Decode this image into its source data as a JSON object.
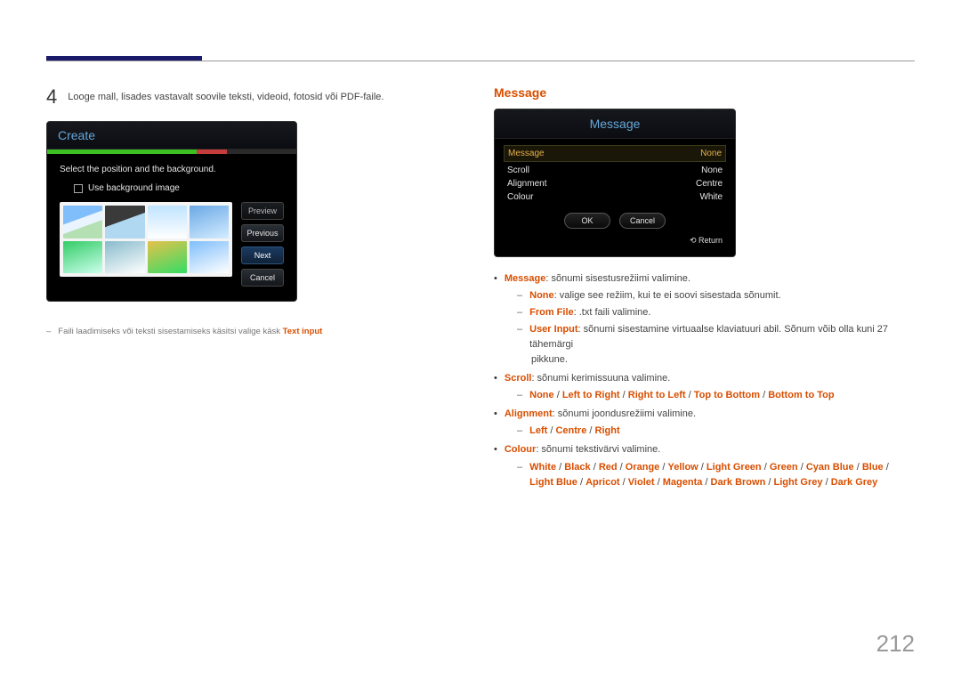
{
  "page_number": "212",
  "left": {
    "step_number": "4",
    "step_text": "Looge mall, lisades vastavalt soovile teksti, videoid, fotosid või PDF-faile.",
    "panel": {
      "title": "Create",
      "subhead": "Select the position and the background.",
      "checkbox_label": "Use background image",
      "buttons": {
        "preview": "Preview",
        "previous": "Previous",
        "next": "Next",
        "cancel": "Cancel"
      }
    },
    "note_prefix": "Faili laadimiseks või teksti sisestamiseks käsitsi valige käsk ",
    "note_highlight": "Text input"
  },
  "right": {
    "heading": "Message",
    "panel": {
      "title": "Message",
      "rows": {
        "message_lbl": "Message",
        "message_val": "None",
        "scroll_lbl": "Scroll",
        "scroll_val": "None",
        "align_lbl": "Alignment",
        "align_val": "Centre",
        "colour_lbl": "Colour",
        "colour_val": "White"
      },
      "ok": "OK",
      "cancel": "Cancel",
      "return": "Return"
    },
    "items": {
      "message_lbl": "Message",
      "message_txt": ": sõnumi sisestusrežiimi valimine.",
      "none_lbl": "None",
      "none_txt": ": valige see režiim, kui te ei soovi sisestada sõnumit.",
      "fromfile_lbl": "From File",
      "fromfile_txt": ": .txt faili valimine.",
      "userinput_lbl": "User Input",
      "userinput_txt": ": sõnumi sisestamine virtuaalse klaviatuuri abil. Sõnum võib olla kuni 27 tähemärgi",
      "userinput_cont": "pikkune.",
      "scroll_lbl": "Scroll",
      "scroll_txt": ": sõnumi kerimissuuna valimine.",
      "scroll_opts": [
        "None",
        "Left to Right",
        "Right to Left",
        "Top to Bottom",
        "Bottom to Top"
      ],
      "alignment_lbl": "Alignment",
      "alignment_txt": ": sõnumi joondusrežiimi valimine.",
      "alignment_opts": [
        "Left",
        "Centre",
        "Right"
      ],
      "colour_lbl": "Colour",
      "colour_txt": ": sõnumi tekstivärvi valimine.",
      "colour_opts": [
        "White",
        "Black",
        "Red",
        "Orange",
        "Yellow",
        "Light Green",
        "Green",
        "Cyan Blue",
        "Blue",
        "Light Blue",
        "Apricot",
        "Violet",
        "Magenta",
        "Dark Brown",
        "Light Grey",
        "Dark Grey"
      ]
    }
  }
}
